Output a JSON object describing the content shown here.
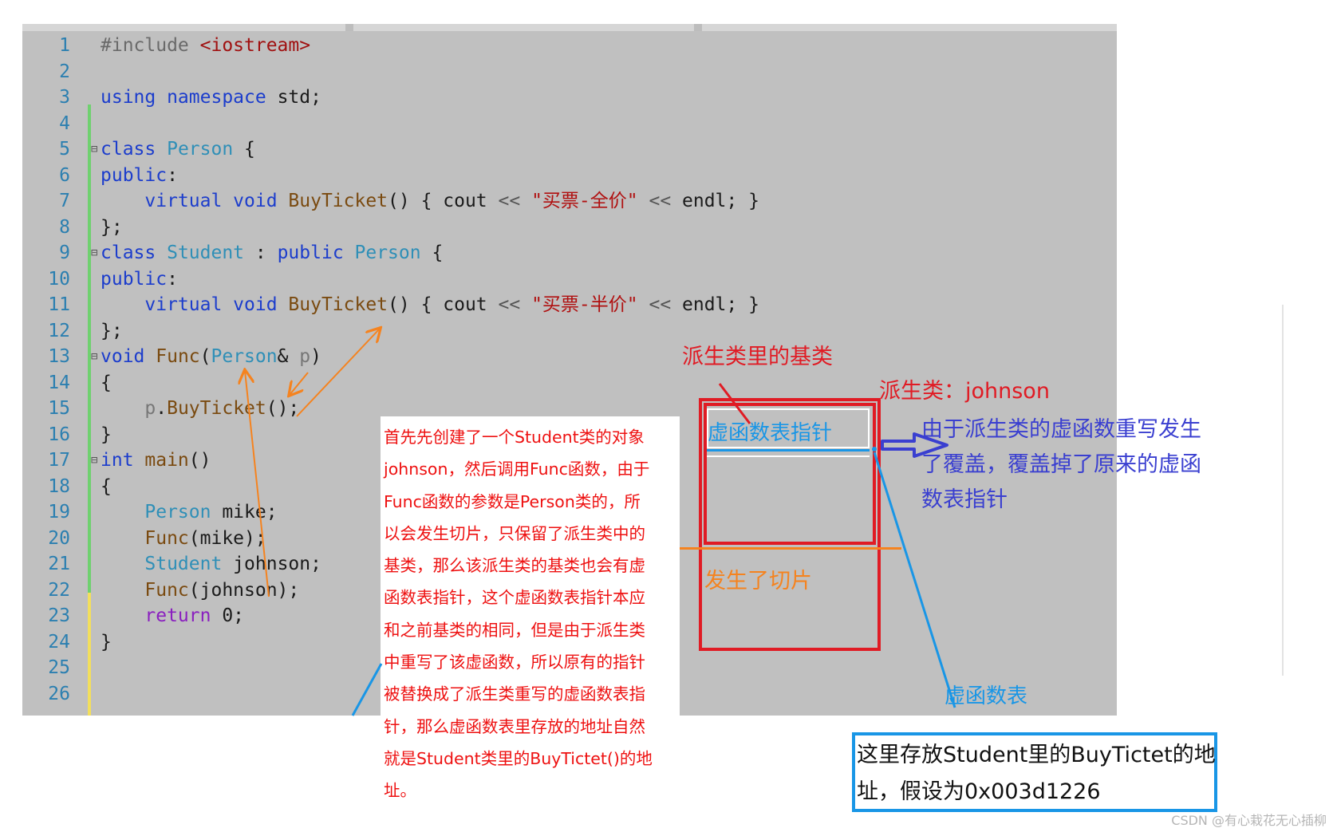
{
  "code": {
    "lines": [
      {
        "n": "1",
        "parts": [
          {
            "t": "#include ",
            "c": "mac"
          },
          {
            "t": "<iostream>",
            "c": "inc"
          }
        ]
      },
      {
        "n": "2",
        "parts": []
      },
      {
        "n": "3",
        "parts": [
          {
            "t": "using namespace ",
            "c": "kw"
          },
          {
            "t": "std;",
            "c": ""
          }
        ]
      },
      {
        "n": "4",
        "parts": []
      },
      {
        "n": "5",
        "fold": true,
        "parts": [
          {
            "t": "class ",
            "c": "kw"
          },
          {
            "t": "Person",
            "c": "ty"
          },
          {
            "t": " {",
            "c": ""
          }
        ]
      },
      {
        "n": "6",
        "parts": [
          {
            "t": "public",
            "c": "kw"
          },
          {
            "t": ":",
            "c": ""
          }
        ]
      },
      {
        "n": "7",
        "parts": [
          {
            "t": "    virtual void ",
            "c": "kw"
          },
          {
            "t": "BuyTicket",
            "c": "fn"
          },
          {
            "t": "() { cout ",
            "c": ""
          },
          {
            "t": "<<",
            "c": "op"
          },
          {
            "t": " \"买票-全价\" ",
            "c": "str"
          },
          {
            "t": "<<",
            "c": "op"
          },
          {
            "t": " endl; }",
            "c": ""
          }
        ]
      },
      {
        "n": "8",
        "parts": [
          {
            "t": "};",
            "c": ""
          }
        ]
      },
      {
        "n": "9",
        "fold": true,
        "parts": [
          {
            "t": "class ",
            "c": "kw"
          },
          {
            "t": "Student",
            "c": "ty"
          },
          {
            "t": " : ",
            "c": ""
          },
          {
            "t": "public ",
            "c": "kw"
          },
          {
            "t": "Person",
            "c": "ty"
          },
          {
            "t": " {",
            "c": ""
          }
        ]
      },
      {
        "n": "10",
        "parts": [
          {
            "t": "public",
            "c": "kw"
          },
          {
            "t": ":",
            "c": ""
          }
        ]
      },
      {
        "n": "11",
        "parts": [
          {
            "t": "    virtual void ",
            "c": "kw"
          },
          {
            "t": "BuyTicket",
            "c": "fn"
          },
          {
            "t": "() { cout ",
            "c": ""
          },
          {
            "t": "<<",
            "c": "op"
          },
          {
            "t": " \"买票-半价\" ",
            "c": "str"
          },
          {
            "t": "<<",
            "c": "op"
          },
          {
            "t": " endl; }",
            "c": ""
          }
        ]
      },
      {
        "n": "12",
        "parts": [
          {
            "t": "};",
            "c": ""
          }
        ]
      },
      {
        "n": "13",
        "fold": true,
        "parts": [
          {
            "t": "void ",
            "c": "kw"
          },
          {
            "t": "Func",
            "c": "fn"
          },
          {
            "t": "(",
            "c": ""
          },
          {
            "t": "Person",
            "c": "ty"
          },
          {
            "t": "& ",
            "c": ""
          },
          {
            "t": "p",
            "c": "ptr"
          },
          {
            "t": ")",
            "c": ""
          }
        ]
      },
      {
        "n": "14",
        "parts": [
          {
            "t": "{",
            "c": ""
          }
        ]
      },
      {
        "n": "15",
        "parts": [
          {
            "t": "    ",
            "c": ""
          },
          {
            "t": "p",
            "c": "ptr"
          },
          {
            "t": ".",
            "c": ""
          },
          {
            "t": "BuyTicket",
            "c": "fn"
          },
          {
            "t": "();",
            "c": ""
          }
        ]
      },
      {
        "n": "16",
        "parts": [
          {
            "t": "}",
            "c": ""
          }
        ]
      },
      {
        "n": "17",
        "fold": true,
        "parts": [
          {
            "t": "int ",
            "c": "kw"
          },
          {
            "t": "main",
            "c": "fn"
          },
          {
            "t": "()",
            "c": ""
          }
        ]
      },
      {
        "n": "18",
        "parts": [
          {
            "t": "{",
            "c": ""
          }
        ]
      },
      {
        "n": "19",
        "parts": [
          {
            "t": "    Person",
            "c": "ty"
          },
          {
            "t": " mike;",
            "c": ""
          }
        ]
      },
      {
        "n": "20",
        "parts": [
          {
            "t": "    Func",
            "c": "fn"
          },
          {
            "t": "(mike);",
            "c": ""
          }
        ]
      },
      {
        "n": "21",
        "parts": [
          {
            "t": "    Student",
            "c": "ty"
          },
          {
            "t": " johnson;",
            "c": ""
          }
        ]
      },
      {
        "n": "22",
        "parts": [
          {
            "t": "    Func",
            "c": "fn"
          },
          {
            "t": "(johnson);",
            "c": ""
          }
        ]
      },
      {
        "n": "23",
        "parts": [
          {
            "t": "    return ",
            "c": "kw2"
          },
          {
            "t": "0;",
            "c": ""
          }
        ]
      },
      {
        "n": "24",
        "parts": [
          {
            "t": "}",
            "c": ""
          }
        ]
      },
      {
        "n": "25",
        "parts": []
      },
      {
        "n": "26",
        "parts": []
      }
    ]
  },
  "explanation": {
    "lines": [
      "首先先创建了一个Student类的对象",
      "johnson，然后调用Func函数，由于",
      "Func函数的参数是Person类的，所",
      "以会发生切片，只保留了派生类中的",
      "基类，那么该派生类的基类也会有虚",
      "函数表指针，这个虚函数表指针本应",
      "和之前基类的相同，但是由于派生类",
      "中重写了该虚函数，所以原有的指针",
      "被替换成了派生类重写的虚函数表指",
      "针，那么虚函数表里存放的地址自然",
      "就是Student类里的BuyTictet()的地",
      "址。"
    ]
  },
  "diagram": {
    "base_in_derived": "派生类里的基类",
    "derived_label": "派生类：johnson",
    "vptr_label": "虚函数表指针",
    "override_note": [
      "由于派生类的虚函数重写发生",
      "了覆盖，覆盖掉了原来的虚函",
      "数表指针"
    ],
    "slicing_label": "发生了切片",
    "vtable_label": "虚函数表",
    "address_note": [
      "这里存放Student里的BuyTictet的地",
      "址，假设为0x003d1226"
    ]
  },
  "watermark": "CSDN @有心栽花无心插柳",
  "colors": {
    "editor_bg": "#c0c0c0",
    "red": "#e01b24",
    "orange": "#f5831f",
    "blue": "#1996e6",
    "indigo": "#3a3fd0"
  }
}
